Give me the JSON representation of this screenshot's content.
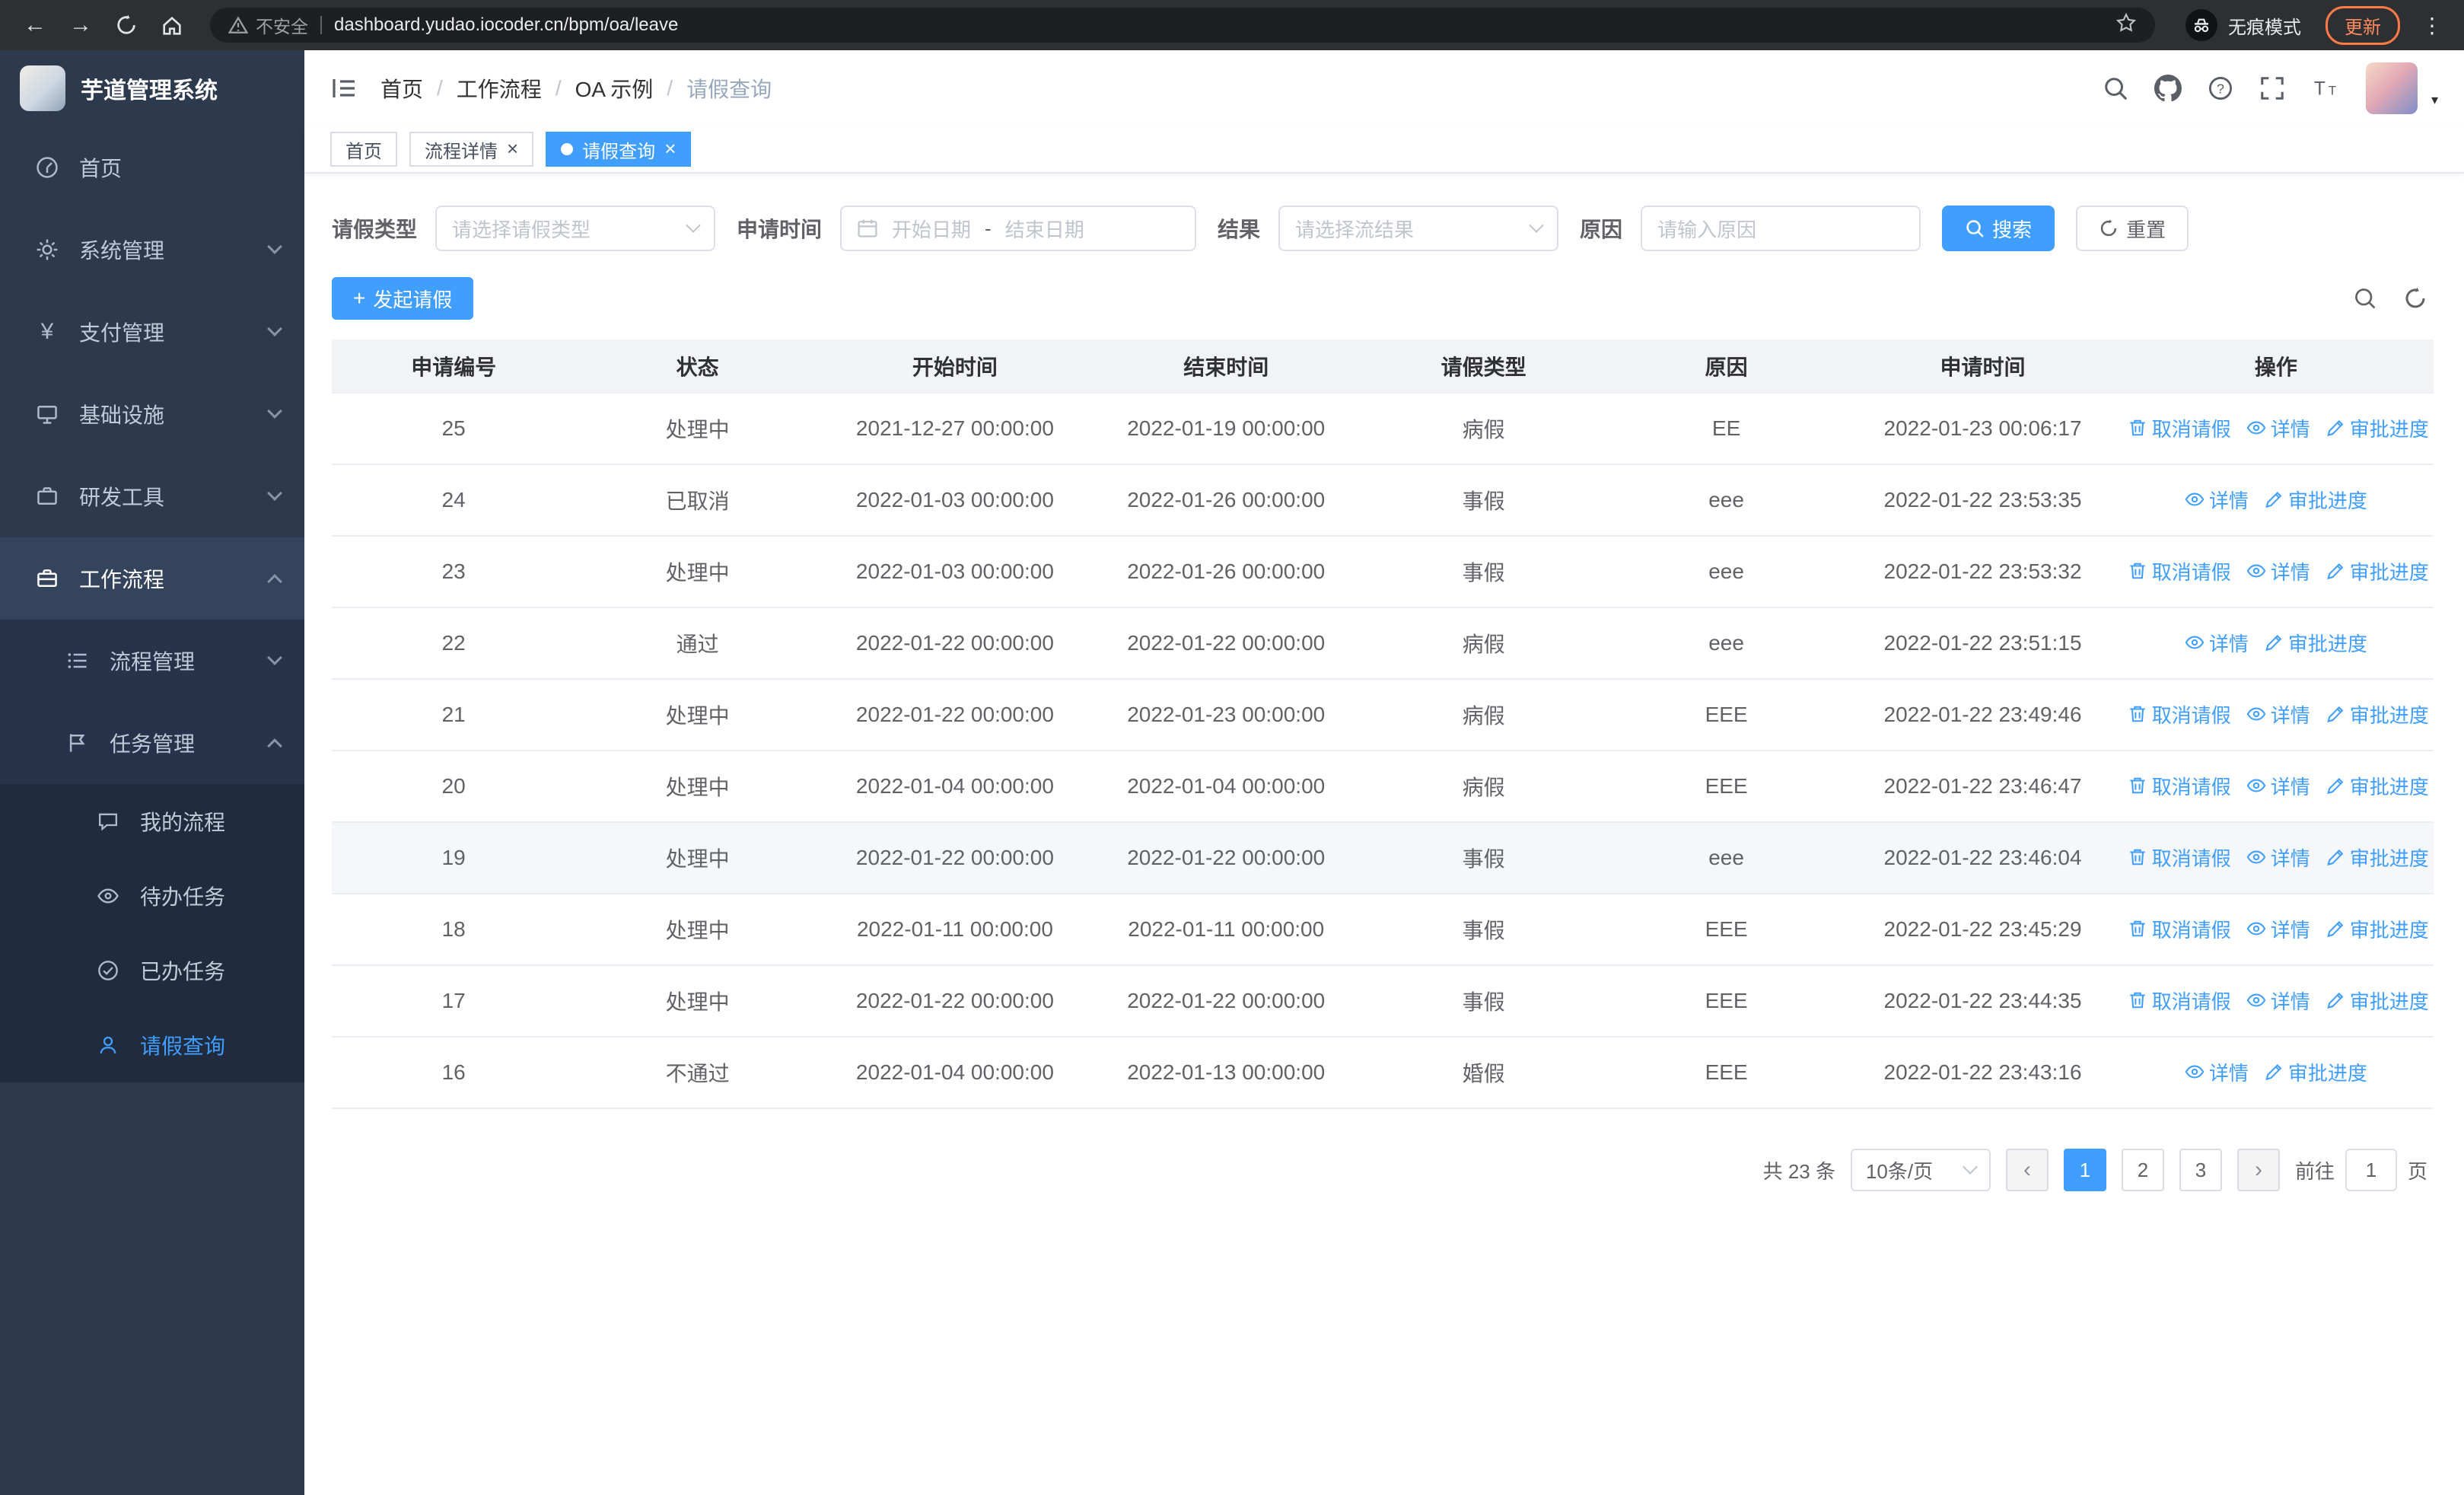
{
  "browser": {
    "security_warning": "不安全",
    "url": "dashboard.yudao.iocoder.cn/bpm/oa/leave",
    "incognito_label": "无痕模式",
    "update_label": "更新"
  },
  "app": {
    "title": "芋道管理系统"
  },
  "sidebar": {
    "items": [
      {
        "label": "首页"
      },
      {
        "label": "系统管理"
      },
      {
        "label": "支付管理"
      },
      {
        "label": "基础设施"
      },
      {
        "label": "研发工具"
      },
      {
        "label": "工作流程"
      },
      {
        "label": "流程管理"
      },
      {
        "label": "任务管理"
      },
      {
        "label": "我的流程"
      },
      {
        "label": "待办任务"
      },
      {
        "label": "已办任务"
      },
      {
        "label": "请假查询"
      }
    ]
  },
  "header": {
    "breadcrumb": [
      "首页",
      "工作流程",
      "OA 示例",
      "请假查询"
    ]
  },
  "tabs": [
    {
      "label": "首页"
    },
    {
      "label": "流程详情"
    },
    {
      "label": "请假查询"
    }
  ],
  "filters": {
    "leave_type_label": "请假类型",
    "leave_type_placeholder": "请选择请假类型",
    "apply_time_label": "申请时间",
    "start_date_placeholder": "开始日期",
    "range_separator": "-",
    "end_date_placeholder": "结束日期",
    "result_label": "结果",
    "result_placeholder": "请选择流结果",
    "reason_label": "原因",
    "reason_placeholder": "请输入原因",
    "search_label": "搜索",
    "reset_label": "重置"
  },
  "toolbar": {
    "create_label": "发起请假"
  },
  "table": {
    "columns": [
      "申请编号",
      "状态",
      "开始时间",
      "结束时间",
      "请假类型",
      "原因",
      "申请时间",
      "操作"
    ],
    "action_labels": {
      "cancel": "取消请假",
      "detail": "详情",
      "progress": "审批进度"
    },
    "rows": [
      {
        "id": "25",
        "status": "处理中",
        "start": "2021-12-27 00:00:00",
        "end": "2022-01-19 00:00:00",
        "type": "病假",
        "reason": "EE",
        "applied": "2022-01-23 00:06:17",
        "actions": [
          "cancel",
          "detail",
          "progress"
        ]
      },
      {
        "id": "24",
        "status": "已取消",
        "start": "2022-01-03 00:00:00",
        "end": "2022-01-26 00:00:00",
        "type": "事假",
        "reason": "eee",
        "applied": "2022-01-22 23:53:35",
        "actions": [
          "detail",
          "progress"
        ]
      },
      {
        "id": "23",
        "status": "处理中",
        "start": "2022-01-03 00:00:00",
        "end": "2022-01-26 00:00:00",
        "type": "事假",
        "reason": "eee",
        "applied": "2022-01-22 23:53:32",
        "actions": [
          "cancel",
          "detail",
          "progress"
        ]
      },
      {
        "id": "22",
        "status": "通过",
        "start": "2022-01-22 00:00:00",
        "end": "2022-01-22 00:00:00",
        "type": "病假",
        "reason": "eee",
        "applied": "2022-01-22 23:51:15",
        "actions": [
          "detail",
          "progress"
        ]
      },
      {
        "id": "21",
        "status": "处理中",
        "start": "2022-01-22 00:00:00",
        "end": "2022-01-23 00:00:00",
        "type": "病假",
        "reason": "EEE",
        "applied": "2022-01-22 23:49:46",
        "actions": [
          "cancel",
          "detail",
          "progress"
        ]
      },
      {
        "id": "20",
        "status": "处理中",
        "start": "2022-01-04 00:00:00",
        "end": "2022-01-04 00:00:00",
        "type": "病假",
        "reason": "EEE",
        "applied": "2022-01-22 23:46:47",
        "actions": [
          "cancel",
          "detail",
          "progress"
        ]
      },
      {
        "id": "19",
        "status": "处理中",
        "start": "2022-01-22 00:00:00",
        "end": "2022-01-22 00:00:00",
        "type": "事假",
        "reason": "eee",
        "applied": "2022-01-22 23:46:04",
        "actions": [
          "cancel",
          "detail",
          "progress"
        ],
        "highlighted": true
      },
      {
        "id": "18",
        "status": "处理中",
        "start": "2022-01-11 00:00:00",
        "end": "2022-01-11 00:00:00",
        "type": "事假",
        "reason": "EEE",
        "applied": "2022-01-22 23:45:29",
        "actions": [
          "cancel",
          "detail",
          "progress"
        ]
      },
      {
        "id": "17",
        "status": "处理中",
        "start": "2022-01-22 00:00:00",
        "end": "2022-01-22 00:00:00",
        "type": "事假",
        "reason": "EEE",
        "applied": "2022-01-22 23:44:35",
        "actions": [
          "cancel",
          "detail",
          "progress"
        ]
      },
      {
        "id": "16",
        "status": "不通过",
        "start": "2022-01-04 00:00:00",
        "end": "2022-01-13 00:00:00",
        "type": "婚假",
        "reason": "EEE",
        "applied": "2022-01-22 23:43:16",
        "actions": [
          "detail",
          "progress"
        ]
      }
    ]
  },
  "pagination": {
    "total_label": "共 23 条",
    "page_size_label": "10条/页",
    "pages": [
      "1",
      "2",
      "3"
    ],
    "active": "1",
    "goto_label": "前往",
    "goto_value": "1",
    "goto_unit": "页"
  }
}
